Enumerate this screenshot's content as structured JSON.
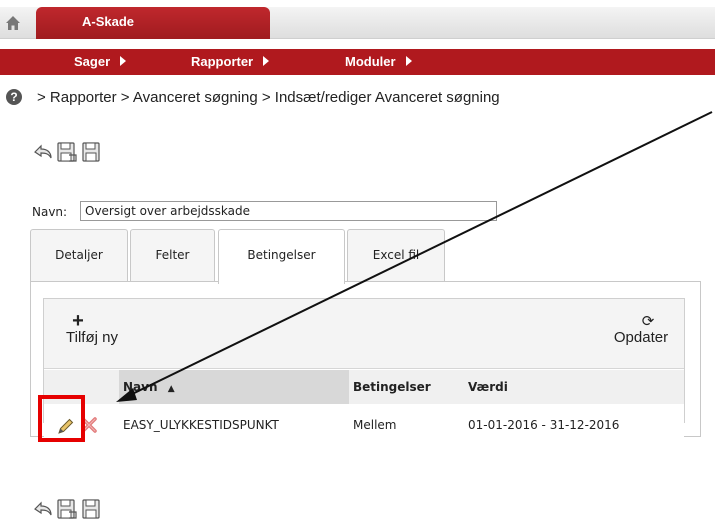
{
  "header": {
    "app_tab_label": "A-Skade"
  },
  "menu": {
    "items": [
      "Sager",
      "Rapporter",
      "Moduler"
    ]
  },
  "breadcrumb": {
    "text": "> Rapporter > Avanceret søgning > Indsæt/rediger Avanceret søgning"
  },
  "icons": {
    "home": "home-icon",
    "help": "help-icon",
    "back": "back-icon",
    "save_close": "save-close-icon",
    "save": "save-icon",
    "edit": "pencil-icon",
    "delete": "delete-x-icon",
    "refresh": "refresh-icon",
    "add": "plus-icon"
  },
  "form": {
    "name_label": "Navn:",
    "name_value": "Oversigt over arbejdsskade"
  },
  "tabs": [
    {
      "label": "Detaljer",
      "active": false
    },
    {
      "label": "Felter",
      "active": false
    },
    {
      "label": "Betingelser",
      "active": true
    },
    {
      "label": "Excel fil",
      "active": false
    }
  ],
  "grid": {
    "add_label": "Tilføj ny",
    "refresh_label": "Opdater",
    "columns": [
      "Navn",
      "Betingelser",
      "Værdi"
    ],
    "sort_indicator": "▲",
    "rows": [
      {
        "navn": "EASY_ULYKKESTIDSPUNKT",
        "betingelser": "Mellem",
        "vaerdi": "01-01-2016 - 31-12-2016"
      }
    ]
  },
  "colors": {
    "brand_red": "#b0191e",
    "highlight_red": "#e60000"
  }
}
